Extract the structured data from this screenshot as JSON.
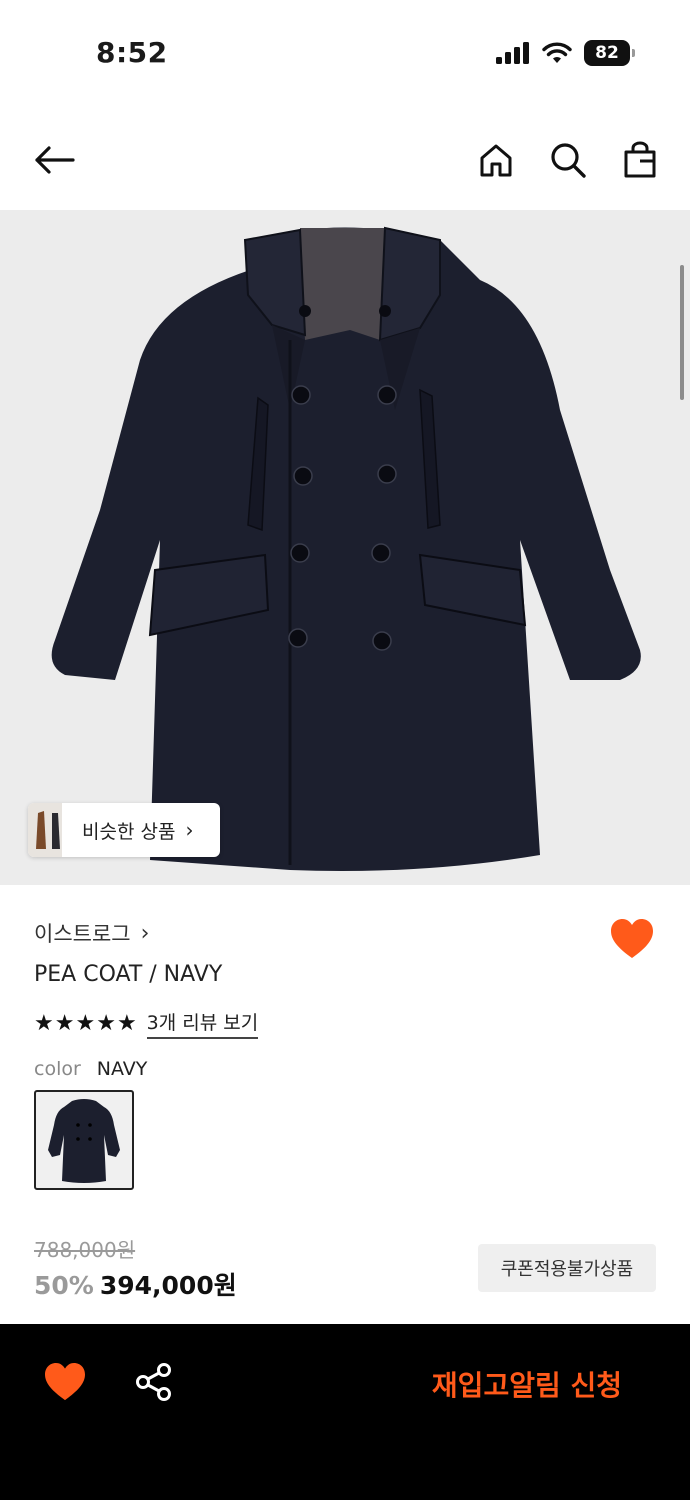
{
  "status_bar": {
    "time": "8:52",
    "battery": "82"
  },
  "header": {
    "back_icon": "arrow-left-icon",
    "home_icon": "home-icon",
    "search_icon": "search-icon",
    "bag_icon": "shopping-bag-icon"
  },
  "product": {
    "similar_label": "비슷한 상품",
    "similar_chevron": "›",
    "brand": "이스트로그",
    "brand_chevron": "›",
    "name": "PEA COAT / NAVY",
    "rating_stars": 5,
    "review_link": "3개 리뷰 보기",
    "color_label": "color",
    "color_value": "NAVY",
    "original_price": "788,000원",
    "discount": "50%",
    "price": "394,000원",
    "coupon_badge": "쿠폰적용불가상품"
  },
  "bottom_bar": {
    "restock_button": "재입고알림 신청"
  },
  "colors": {
    "accent": "#ff5a1a",
    "coat": "#1c1f2e",
    "background_image": "#ececec"
  }
}
